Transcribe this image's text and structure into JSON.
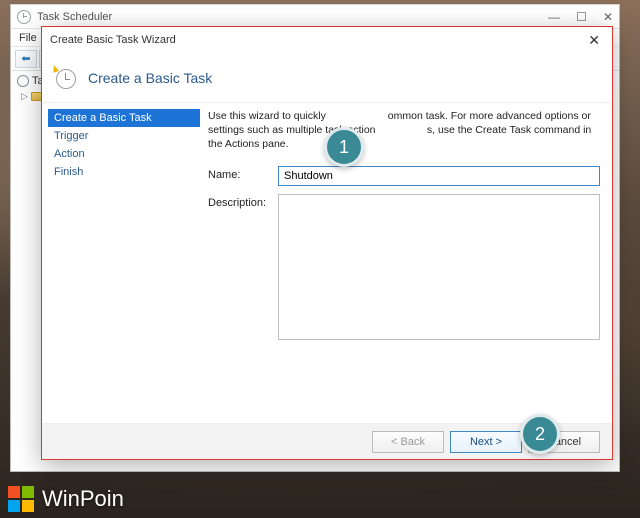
{
  "parent": {
    "title": "Task Scheduler",
    "menu_file": "File",
    "tree_root": "Tas",
    "nav_back_glyph": "⬅",
    "nav_fwd_glyph": "➡"
  },
  "dialog": {
    "title": "Create Basic Task Wizard",
    "header": "Create a Basic Task",
    "intro_pre": "Use this wizard to quickly ",
    "intro_mid": "ommon task.  For more advanced options or settings such as multiple task action",
    "intro_post": "s, use the Create Task command in the Actions pane.",
    "steps": [
      {
        "label": "Create a Basic Task",
        "active": true
      },
      {
        "label": "Trigger",
        "active": false
      },
      {
        "label": "Action",
        "active": false
      },
      {
        "label": "Finish",
        "active": false
      }
    ],
    "name_label": "Name:",
    "name_value": "Shutdown",
    "desc_label": "Description:",
    "desc_value": "",
    "buttons": {
      "back": "< Back",
      "next": "Next >",
      "cancel": "Cancel"
    }
  },
  "callouts": {
    "one": "1",
    "two": "2"
  },
  "brand": {
    "text": "WinPoin"
  }
}
